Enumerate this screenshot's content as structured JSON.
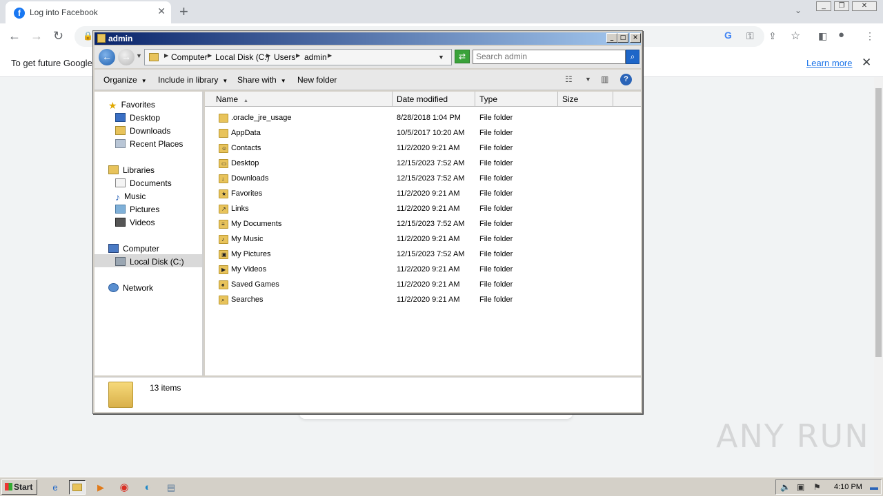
{
  "browser": {
    "tab_title": "Log into Facebook",
    "tab_favicon_letter": "f",
    "infobar_message": "To get future Google",
    "learn_more": "Learn more"
  },
  "explorer": {
    "title": "admin",
    "breadcrumbs": [
      "Computer",
      "Local Disk (C:)",
      "Users",
      "admin"
    ],
    "search_placeholder": "Search admin",
    "toolbar": {
      "organize": "Organize",
      "include_in_library": "Include in library",
      "share_with": "Share with",
      "new_folder": "New folder"
    },
    "nav": {
      "favorites": "Favorites",
      "desktop": "Desktop",
      "downloads": "Downloads",
      "recent_places": "Recent Places",
      "libraries": "Libraries",
      "documents": "Documents",
      "music": "Music",
      "pictures": "Pictures",
      "videos": "Videos",
      "computer": "Computer",
      "local_disk": "Local Disk (C:)",
      "network": "Network"
    },
    "columns": {
      "name": "Name",
      "date_modified": "Date modified",
      "type": "Type",
      "size": "Size"
    },
    "files": [
      {
        "name": ".oracle_jre_usage",
        "date": "8/28/2018 1:04 PM",
        "type": "File folder",
        "icon": "folder-icon"
      },
      {
        "name": "AppData",
        "date": "10/5/2017 10:20 AM",
        "type": "File folder",
        "icon": "folder-icon"
      },
      {
        "name": "Contacts",
        "date": "11/2/2020 9:21 AM",
        "type": "File folder",
        "icon": "contacts-folder-icon"
      },
      {
        "name": "Desktop",
        "date": "12/15/2023 7:52 AM",
        "type": "File folder",
        "icon": "desktop-folder-icon"
      },
      {
        "name": "Downloads",
        "date": "12/15/2023 7:52 AM",
        "type": "File folder",
        "icon": "downloads-folder-icon"
      },
      {
        "name": "Favorites",
        "date": "11/2/2020 9:21 AM",
        "type": "File folder",
        "icon": "favorites-folder-icon"
      },
      {
        "name": "Links",
        "date": "11/2/2020 9:21 AM",
        "type": "File folder",
        "icon": "links-folder-icon"
      },
      {
        "name": "My Documents",
        "date": "12/15/2023 7:52 AM",
        "type": "File folder",
        "icon": "documents-folder-icon"
      },
      {
        "name": "My Music",
        "date": "11/2/2020 9:21 AM",
        "type": "File folder",
        "icon": "music-folder-icon"
      },
      {
        "name": "My Pictures",
        "date": "12/15/2023 7:52 AM",
        "type": "File folder",
        "icon": "pictures-folder-icon"
      },
      {
        "name": "My Videos",
        "date": "11/2/2020 9:21 AM",
        "type": "File folder",
        "icon": "videos-folder-icon"
      },
      {
        "name": "Saved Games",
        "date": "11/2/2020 9:21 AM",
        "type": "File folder",
        "icon": "games-folder-icon"
      },
      {
        "name": "Searches",
        "date": "11/2/2020 9:21 AM",
        "type": "File folder",
        "icon": "searches-folder-icon"
      }
    ],
    "item_count": "13 items"
  },
  "taskbar": {
    "start": "Start",
    "clock": "4:10 PM"
  },
  "watermark": "ANY RUN"
}
